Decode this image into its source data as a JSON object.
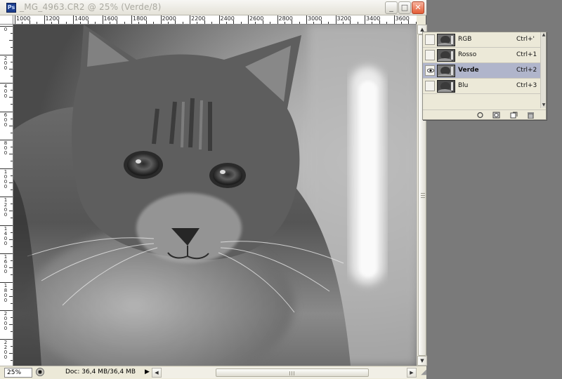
{
  "document": {
    "title": "_MG_4963.CR2 @ 25% (Verde/8)",
    "app_icon_text": "Ps"
  },
  "window_controls": {
    "minimize": "_",
    "maximize": "□",
    "close": "✕"
  },
  "rulers": {
    "horizontal": [
      "1000",
      "1200",
      "1400",
      "1600",
      "1800",
      "2000",
      "2200",
      "2400",
      "2600",
      "2800",
      "3000",
      "3200",
      "3400",
      "3600"
    ],
    "vertical": [
      "0",
      "2\n0\n0",
      "4\n0\n0",
      "6\n0\n0",
      "8\n0\n0",
      "1\n0\n0\n0",
      "1\n2\n0\n0",
      "1\n4\n0\n0",
      "1\n6\n0\n0",
      "1\n8\n0\n0",
      "2\n0\n0\n0",
      "2\n2\n0\n0",
      "2\n4\n0\n0"
    ]
  },
  "status": {
    "zoom": "25%",
    "doc_info": "Doc: 36,4 MB/36,4 MB",
    "arrow": "▶"
  },
  "channels": [
    {
      "name": "RGB",
      "shortcut": "Ctrl+'",
      "visible": false,
      "selected": false
    },
    {
      "name": "Rosso",
      "shortcut": "Ctrl+1",
      "visible": false,
      "selected": false
    },
    {
      "name": "Verde",
      "shortcut": "Ctrl+2",
      "visible": true,
      "selected": true
    },
    {
      "name": "Blu",
      "shortcut": "Ctrl+3",
      "visible": false,
      "selected": false
    }
  ],
  "panel_footer_icons": [
    "load-selection-icon",
    "save-selection-icon",
    "new-channel-icon",
    "delete-channel-icon"
  ],
  "colors": {
    "workspace": "#7a7a7a",
    "selected_row": "#b0b5cb",
    "close_button": "#e45d35"
  }
}
